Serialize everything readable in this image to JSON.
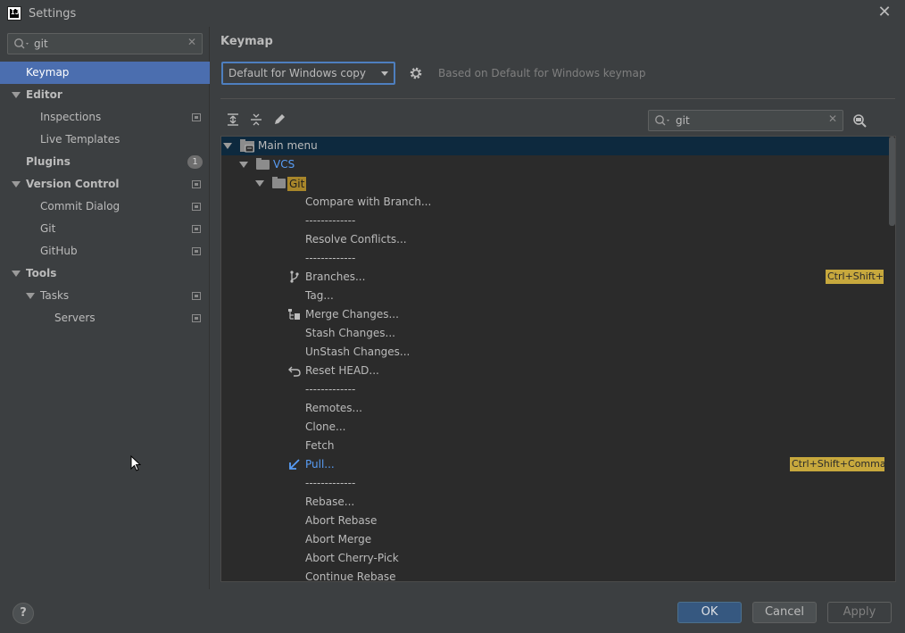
{
  "window": {
    "title": "Settings",
    "logo_text": "IJ",
    "close_glyph": "✕"
  },
  "sidebar": {
    "search_value": "git",
    "search_clear": "✕",
    "items": [
      {
        "label": "Keymap"
      },
      {
        "label": "Editor"
      },
      {
        "label": "Inspections"
      },
      {
        "label": "Live Templates"
      },
      {
        "label": "Plugins",
        "badge": "1"
      },
      {
        "label": "Version Control"
      },
      {
        "label": "Commit Dialog"
      },
      {
        "label": "Git"
      },
      {
        "label": "GitHub"
      },
      {
        "label": "Tools"
      },
      {
        "label": "Tasks"
      },
      {
        "label": "Servers"
      }
    ]
  },
  "main": {
    "title": "Keymap",
    "keymap_selected": "Default for Windows copy",
    "based_on": "Based on Default for Windows keymap",
    "tree_search_value": "git",
    "tree_search_clear": "✕"
  },
  "tree": {
    "rows": [
      {
        "label": "Main menu"
      },
      {
        "label": "VCS"
      },
      {
        "label": "Git"
      },
      {
        "label": "Compare with Branch..."
      },
      {
        "label": "-------------"
      },
      {
        "label": "Resolve Conflicts..."
      },
      {
        "label": "-------------"
      },
      {
        "label": "Branches...",
        "shortcut": "Ctrl+Shift+`"
      },
      {
        "label": "Tag..."
      },
      {
        "label": "Merge Changes..."
      },
      {
        "label": "Stash Changes..."
      },
      {
        "label": "UnStash Changes..."
      },
      {
        "label": "Reset HEAD..."
      },
      {
        "label": "-------------"
      },
      {
        "label": "Remotes..."
      },
      {
        "label": "Clone..."
      },
      {
        "label": "Fetch"
      },
      {
        "label": "Pull...",
        "shortcut": "Ctrl+Shift+Comma"
      },
      {
        "label": "-------------"
      },
      {
        "label": "Rebase..."
      },
      {
        "label": "Abort Rebase"
      },
      {
        "label": "Abort Merge"
      },
      {
        "label": "Abort Cherry-Pick"
      },
      {
        "label": "Continue Rebase"
      }
    ]
  },
  "footer": {
    "help": "?",
    "ok": "OK",
    "cancel": "Cancel",
    "apply": "Apply"
  }
}
